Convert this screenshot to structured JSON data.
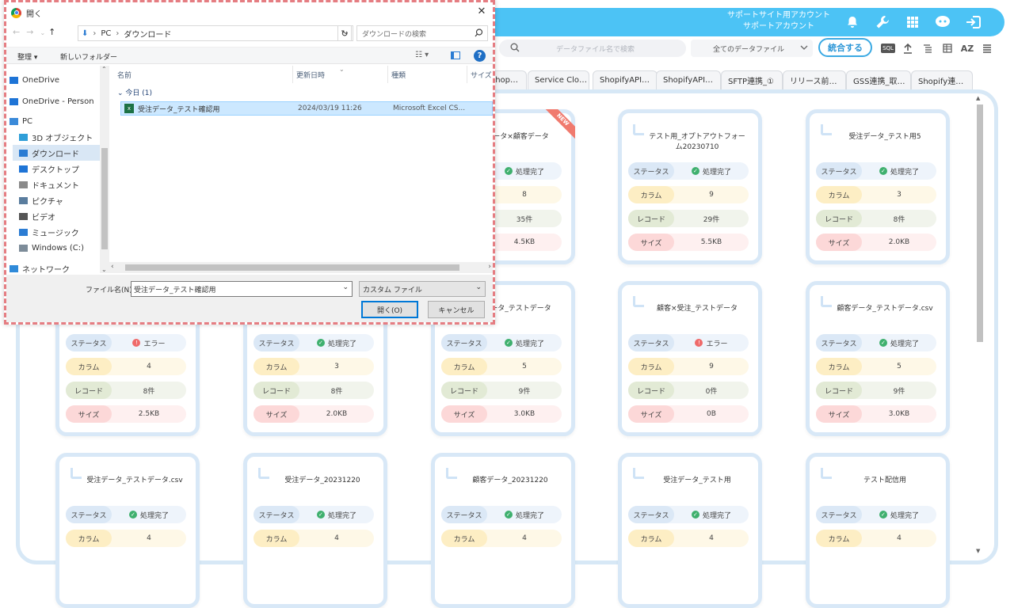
{
  "header": {
    "account_line1": "サポートサイト用アカウント",
    "account_line2": "サポートアカウント"
  },
  "toolbar": {
    "search_placeholder": "データファイル名で検索",
    "filter_value": "全てのデータファイル",
    "merge_label": "統合する",
    "sql_label": "SQL",
    "az_label": "AZ"
  },
  "tabs": [
    "shop…",
    "Service Clo…",
    "ShopifyAPI…",
    "ShopifyAPI…",
    "SFTP連携_①",
    "リリース前…",
    "GSS連携_取…",
    "Shopify連…"
  ],
  "labels": {
    "status": "ステータス",
    "column": "カラム",
    "record": "レコード",
    "size": "サイズ"
  },
  "new_badge": "NEW",
  "cards": [
    {
      "name": "受注データ×顧客データ",
      "status": "処理完了",
      "ok": true,
      "col": "8",
      "rec": "35件",
      "size": "4.5KB",
      "isnew": true
    },
    {
      "name": "テスト用_オプトアウトフォーム20230710",
      "status": "処理完了",
      "ok": true,
      "col": "9",
      "rec": "29件",
      "size": "5.5KB"
    },
    {
      "name": "受注データ_テスト用5",
      "status": "処理完了",
      "ok": true,
      "col": "3",
      "rec": "8件",
      "size": "2.0KB"
    },
    {
      "name": "",
      "status": "エラー",
      "ok": false,
      "col": "4",
      "rec": "8件",
      "size": "2.5KB"
    },
    {
      "name": "",
      "status": "処理完了",
      "ok": true,
      "col": "3",
      "rec": "8件",
      "size": "2.0KB"
    },
    {
      "name": "受注データ_テストデータ",
      "status": "処理完了",
      "ok": true,
      "col": "5",
      "rec": "9件",
      "size": "3.0KB"
    },
    {
      "name": "顧客×受注_テストデータ",
      "status": "エラー",
      "ok": false,
      "col": "9",
      "rec": "0件",
      "size": "0B"
    },
    {
      "name": "顧客データ_テストデータ.csv",
      "status": "処理完了",
      "ok": true,
      "col": "5",
      "rec": "9件",
      "size": "3.0KB"
    },
    {
      "name": "受注データ_テストデータ.csv",
      "status": "処理完了",
      "ok": true,
      "col": "4"
    },
    {
      "name": "受注データ_20231220",
      "status": "処理完了",
      "ok": true,
      "col": "4"
    },
    {
      "name": "顧客データ_20231220",
      "status": "処理完了",
      "ok": true,
      "col": "4"
    },
    {
      "name": "受注データ_テスト用",
      "status": "処理完了",
      "ok": true,
      "col": "4"
    },
    {
      "name": "テスト配信用",
      "status": "処理完了",
      "ok": true,
      "col": "4"
    }
  ],
  "dialog": {
    "title": "開く",
    "path": [
      "PC",
      "ダウンロード"
    ],
    "search_placeholder": "ダウンロードの検索",
    "organize": "整理 ▾",
    "new_folder": "新しいフォルダー",
    "nav": [
      "OneDrive",
      "OneDrive - Person",
      "PC",
      "3D オブジェクト",
      "ダウンロード",
      "デスクトップ",
      "ドキュメント",
      "ピクチャ",
      "ビデオ",
      "ミュージック",
      "Windows (C:)",
      "ネットワーク"
    ],
    "columns": [
      "名前",
      "更新日時",
      "種類",
      "サイズ"
    ],
    "group": "今日 (1)",
    "file": {
      "name": "受注データ_テスト確認用",
      "date": "2024/03/19 11:26",
      "type": "Microsoft Excel CS..."
    },
    "filename_label": "ファイル名(N):",
    "filename_value": "受注データ_テスト確認用",
    "filetype": "カスタム ファイル",
    "open_label": "開く(O)",
    "cancel_label": "キャンセル"
  }
}
